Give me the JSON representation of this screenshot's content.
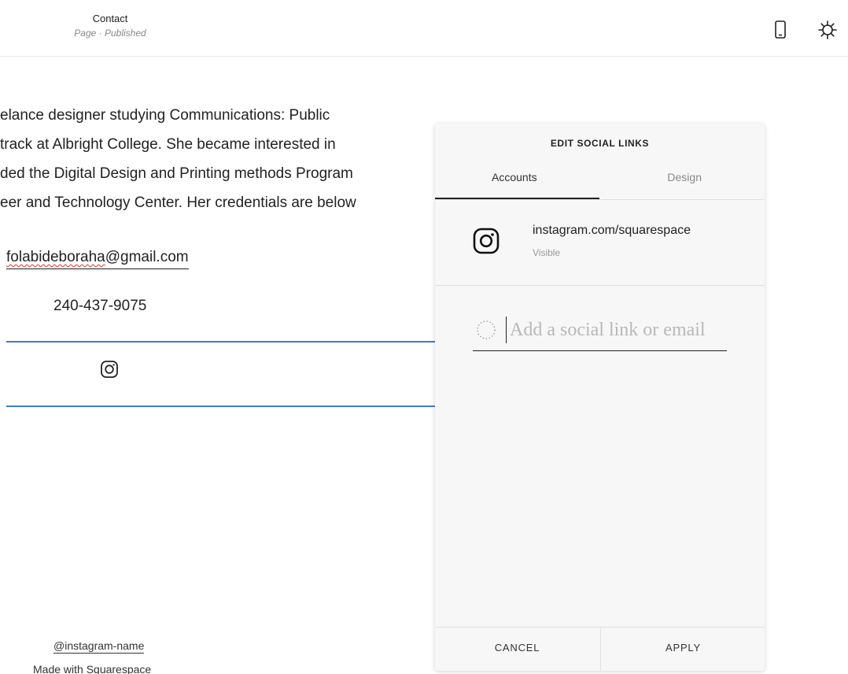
{
  "header": {
    "page_title": "Contact",
    "page_status": "Page · Published",
    "icons": {
      "mobile": "mobile-preview-icon",
      "settings": "gear-icon"
    }
  },
  "content": {
    "bio_lines": [
      "elance designer studying Communications: Public",
      " track at Albright College. She became interested in",
      "ded the Digital Design and Printing methods Program",
      "eer and Technology Center. Her credentials are below"
    ],
    "email_user": "folabideboraha",
    "email_domain": "@gmail.com",
    "phone": "240-437-9075",
    "social_icon": "instagram-icon"
  },
  "footer": {
    "handle": "@instagram-name",
    "made_with": "Made with Squarespace"
  },
  "panel": {
    "title": "EDIT SOCIAL LINKS",
    "tabs": [
      {
        "label": "Accounts",
        "active": true
      },
      {
        "label": "Design",
        "active": false
      }
    ],
    "accounts": [
      {
        "url": "instagram.com/squarespace",
        "status": "Visible",
        "icon": "instagram-icon"
      }
    ],
    "add_placeholder": "Add a social link or email",
    "cancel_label": "CANCEL",
    "apply_label": "APPLY"
  },
  "colors": {
    "accent_line": "#3b7fc9",
    "panel_bg": "#f7f7f7",
    "spellcheck": "#d33"
  }
}
